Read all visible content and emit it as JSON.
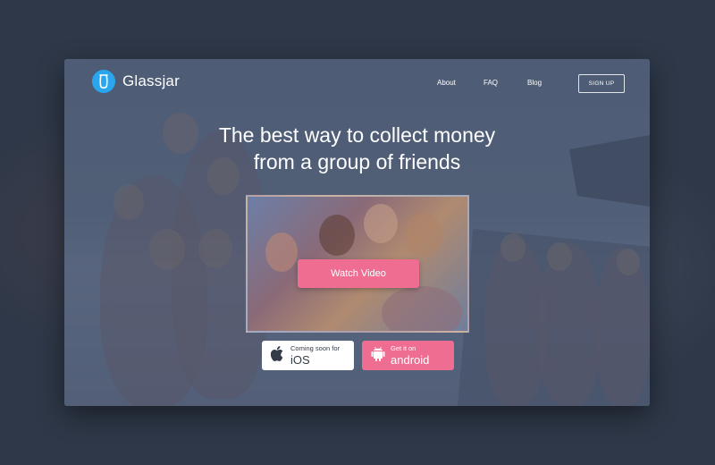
{
  "brand": {
    "name": "Glassjar",
    "logo_icon": "jar-icon",
    "accent": "#2aa6ef"
  },
  "nav": {
    "links": [
      "About",
      "FAQ",
      "Blog"
    ],
    "signup_label": "SIGN UP"
  },
  "hero": {
    "headline_line1": "The best way to collect money",
    "headline_line2": "from a group of friends",
    "video_button": "Watch Video"
  },
  "stores": {
    "ios": {
      "small": "Coming soon for",
      "big": "iOS",
      "icon": "apple-icon"
    },
    "android": {
      "small": "Get it on",
      "big": "android",
      "icon": "android-icon"
    }
  },
  "colors": {
    "primary_pink": "#ef6d91",
    "overlay": "#4b5a72",
    "text": "#ffffff"
  }
}
